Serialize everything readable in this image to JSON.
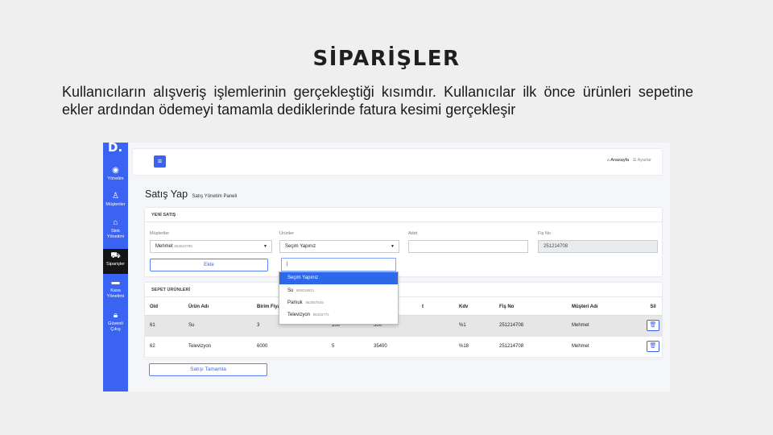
{
  "slide": {
    "title": "SİPARİŞLER",
    "description": "Kullanıcıların alışveriş işlemlerinin gerçekleştiği kısımdır. Kullanıcılar ilk önce ürünleri sepetine ekler ardından ödemeyi tamamla dediklerinde fatura kesimi gerçekleşir"
  },
  "sidebar": {
    "logo": "D.",
    "items": [
      {
        "icon": "dashboard-icon",
        "label": "Yönetim"
      },
      {
        "icon": "user-icon",
        "label": "Müşteriler"
      },
      {
        "icon": "basket-icon",
        "label": "Stok Yönetimi"
      },
      {
        "icon": "cart-icon",
        "label": "Siparişler"
      },
      {
        "icon": "cash-register-icon",
        "label": "Kasa Yönetimi"
      },
      {
        "icon": "lock-icon",
        "label": "Güvenli Çıkış"
      }
    ]
  },
  "topbar": {
    "menu_icon": "hamburger-icon",
    "home": "Anasayfa",
    "settings": "Ayarlar"
  },
  "page": {
    "title": "Satış Yap",
    "subtitle": "Satış Yönetim Paneli"
  },
  "new_sale": {
    "header": "YENİ SATIŞ",
    "customer_label": "Müşteriler",
    "customer_name": "Mehmet",
    "customer_code": "862610790",
    "products_label": "Ürünler",
    "products_value": "Seçim Yapınız",
    "qty_label": "Adet",
    "qty_value": "",
    "receipt_label": "Fiş No",
    "receipt_value": "251214708",
    "add_button": "Ekle",
    "search_value": "|"
  },
  "dropdown": {
    "options": [
      {
        "name": "Seçim Yapınız",
        "code": ""
      },
      {
        "name": "Su",
        "code": "863016811"
      },
      {
        "name": "Pamuk",
        "code": "863057545"
      },
      {
        "name": "Televizyon",
        "code": "85415771"
      }
    ]
  },
  "cart": {
    "header": "SEPET ÜRÜNLERİ",
    "columns": [
      "Oid",
      "Ürün Adı",
      "Birim Fiyat",
      "t",
      "Kdv",
      "Fiş No",
      "Müşteri Adı",
      "Sil"
    ],
    "rows": [
      {
        "oid": "61",
        "product": "Su",
        "price": "3",
        "qty": "100",
        "total": "300",
        "kdv": "%1",
        "receipt": "251214708",
        "customer": "Mehmet"
      },
      {
        "oid": "62",
        "product": "Televizyon",
        "price": "6000",
        "qty": "5",
        "total": "35400",
        "kdv": "%18",
        "receipt": "251214708",
        "customer": "Mehmet"
      }
    ],
    "complete_button": "Satışı Tamamla"
  }
}
